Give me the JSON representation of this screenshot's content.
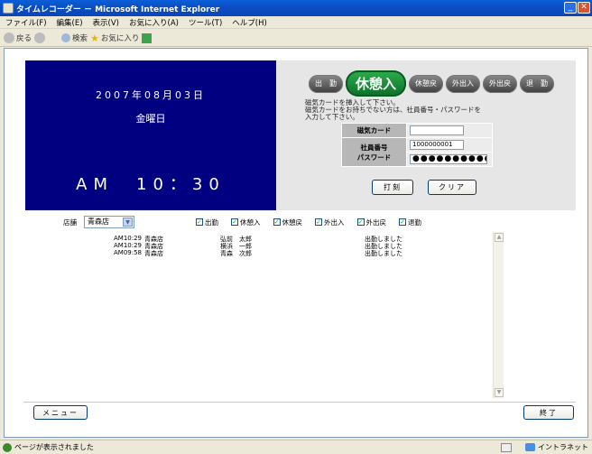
{
  "window": {
    "title": "タイムレコーダー － Microsoft Internet Explorer"
  },
  "menu": [
    "ファイル(F)",
    "編集(E)",
    "表示(V)",
    "お気に入り(A)",
    "ツール(T)",
    "ヘルプ(H)"
  ],
  "toolbar": {
    "back": "戻る",
    "search": "検索",
    "favorites": "お気に入り"
  },
  "clock": {
    "date": "2007年08月03日",
    "weekday": "金曜日",
    "time": "AM　10：30"
  },
  "actions": {
    "shukkin": "出　勤",
    "kyukeiiri": "休憩入",
    "kyukeimodori": "休憩戻",
    "gaishutsu_iri": "外出入",
    "gaishutsu_modori": "外出戻",
    "taikin": "退　勤"
  },
  "instructions": {
    "line1": "磁気カードを挿入して下さい。",
    "line2": "磁気カードをお持ちでない方は、社員番号・パスワードを",
    "line3": "入力して下さい。"
  },
  "form": {
    "card_label": "磁気カード",
    "card_value": "",
    "emp_label_1": "社員番号",
    "emp_label_2": "パスワード",
    "emp_value": "1000000001",
    "password_value": "●●●●●●●●●●"
  },
  "buttons": {
    "print": "打刻",
    "clear": "クリア",
    "menu": "メニュー",
    "end": "終了"
  },
  "filter": {
    "store_label": "店舗",
    "store_value": "青森店",
    "checks": [
      "出勤",
      "休憩入",
      "休憩戻",
      "外出入",
      "外出戻",
      "退勤"
    ]
  },
  "log": [
    {
      "time": "AM10:29",
      "store": "青森店",
      "name": "弘前　太郎",
      "message": "出勤しました"
    },
    {
      "time": "AM10:29",
      "store": "青森店",
      "name": "横浜　一郎",
      "message": "出勤しました"
    },
    {
      "time": "AM09:58",
      "store": "青森店",
      "name": "青森　次郎",
      "message": "出勤しました"
    }
  ],
  "status": {
    "left": "ページが表示されました",
    "zone": "イントラネット"
  }
}
